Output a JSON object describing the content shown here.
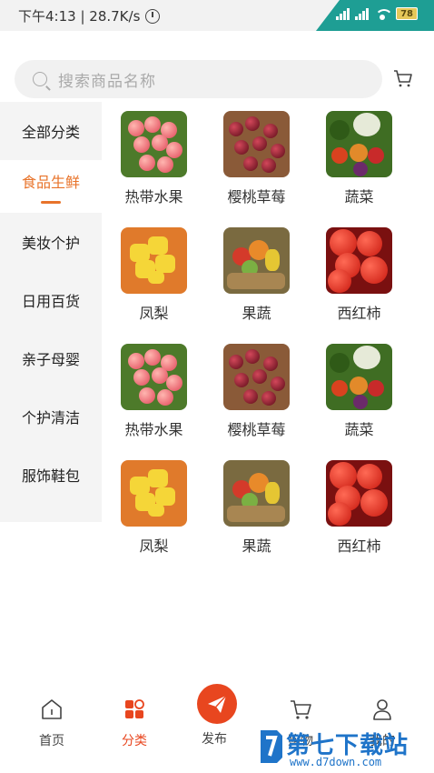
{
  "status_bar": {
    "time_speed": "下午4:13 | 28.7K/s",
    "battery": "78",
    "accent_color": "#1e9e94"
  },
  "search": {
    "placeholder": "搜索商品名称"
  },
  "sidebar": {
    "items": [
      {
        "label": "全部分类"
      },
      {
        "label": "食品生鲜",
        "active": true
      },
      {
        "label": "美妆个护"
      },
      {
        "label": "日用百货"
      },
      {
        "label": "亲子母婴"
      },
      {
        "label": "个护清洁"
      },
      {
        "label": "服饰鞋包"
      }
    ],
    "active_color": "#e8732a"
  },
  "grid": {
    "items": [
      {
        "label": "热带水果",
        "icon": "lychee-image"
      },
      {
        "label": "樱桃草莓",
        "icon": "cherry-image"
      },
      {
        "label": "蔬菜",
        "icon": "vegetables-image"
      },
      {
        "label": "凤梨",
        "icon": "pineapple-image"
      },
      {
        "label": "果蔬",
        "icon": "fruit-basket-image"
      },
      {
        "label": "西红柿",
        "icon": "tomato-image"
      },
      {
        "label": "热带水果",
        "icon": "lychee-image"
      },
      {
        "label": "樱桃草莓",
        "icon": "cherry-image"
      },
      {
        "label": "蔬菜",
        "icon": "vegetables-image"
      },
      {
        "label": "凤梨",
        "icon": "pineapple-image"
      },
      {
        "label": "果蔬",
        "icon": "fruit-basket-image"
      },
      {
        "label": "西红柿",
        "icon": "tomato-image"
      }
    ]
  },
  "bottom_nav": {
    "home": "首页",
    "category": "分类",
    "publish": "发布",
    "cart": "购物",
    "mine": "我的",
    "active_color": "#e8461f"
  },
  "watermark": {
    "title": "第七下载站",
    "url": "www.d7down.com"
  }
}
